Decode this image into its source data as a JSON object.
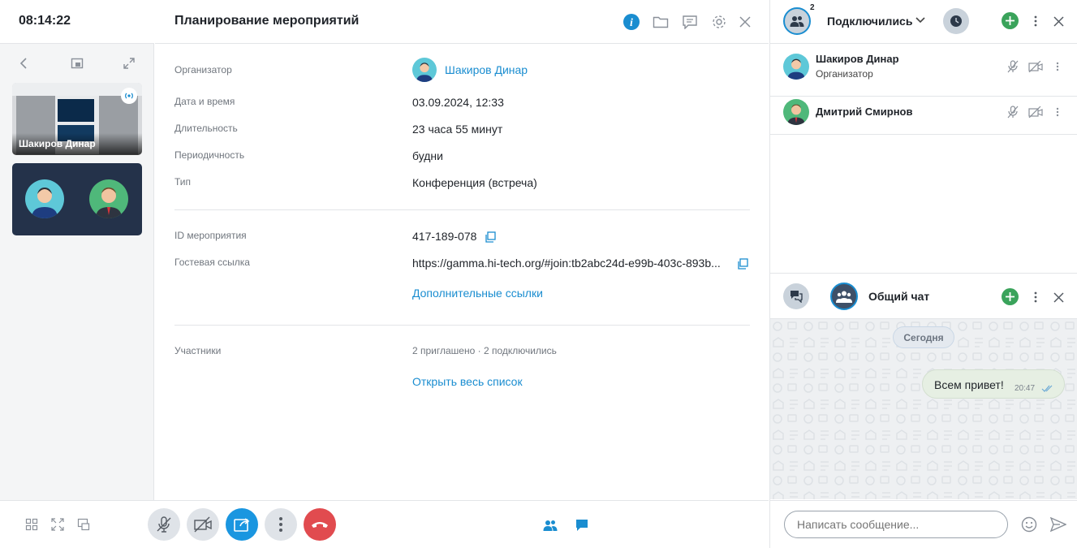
{
  "clock": "08:14:22",
  "tiles": [
    {
      "name": "Шакиров Динар"
    }
  ],
  "meeting": {
    "title": "Планирование мероприятий",
    "rows": {
      "organizer": {
        "label": "Организатор",
        "value": "Шакиров Динар"
      },
      "datetime": {
        "label": "Дата и время",
        "value": "03.09.2024, 12:33"
      },
      "duration": {
        "label": "Длительность",
        "value": "23 часа 55 минут"
      },
      "periodicity": {
        "label": "Периодичность",
        "value": "будни"
      },
      "type": {
        "label": "Тип",
        "value": "Конференция (встреча)"
      },
      "event_id": {
        "label": "ID мероприятия",
        "value": "417-189-078"
      },
      "guest_link": {
        "label": "Гостевая ссылка",
        "value": "https://gamma.hi-tech.org/#join:tb2abc24d-e99b-403c-893b..."
      },
      "more_links": "Дополнительные ссылки",
      "participants": {
        "label": "Участники",
        "value": "2 приглашено · 2 подключились"
      },
      "open_list": "Открыть весь список"
    }
  },
  "participants_panel": {
    "badge_count": "2",
    "filter_label": "Подключились",
    "people": [
      {
        "name": "Шакиров Динар",
        "role": "Организатор"
      },
      {
        "name": "Дмитрий Смирнов",
        "role": ""
      }
    ]
  },
  "chat": {
    "title": "Общий чат",
    "date_divider": "Сегодня",
    "messages": [
      {
        "text": "Всем привет!",
        "time": "20:47"
      }
    ],
    "input_placeholder": "Написать сообщение..."
  },
  "colors": {
    "accent": "#1a8dd0",
    "hangup": "#e14b4f",
    "add_green": "#3aa35b",
    "share_blue": "#1a96e0"
  }
}
